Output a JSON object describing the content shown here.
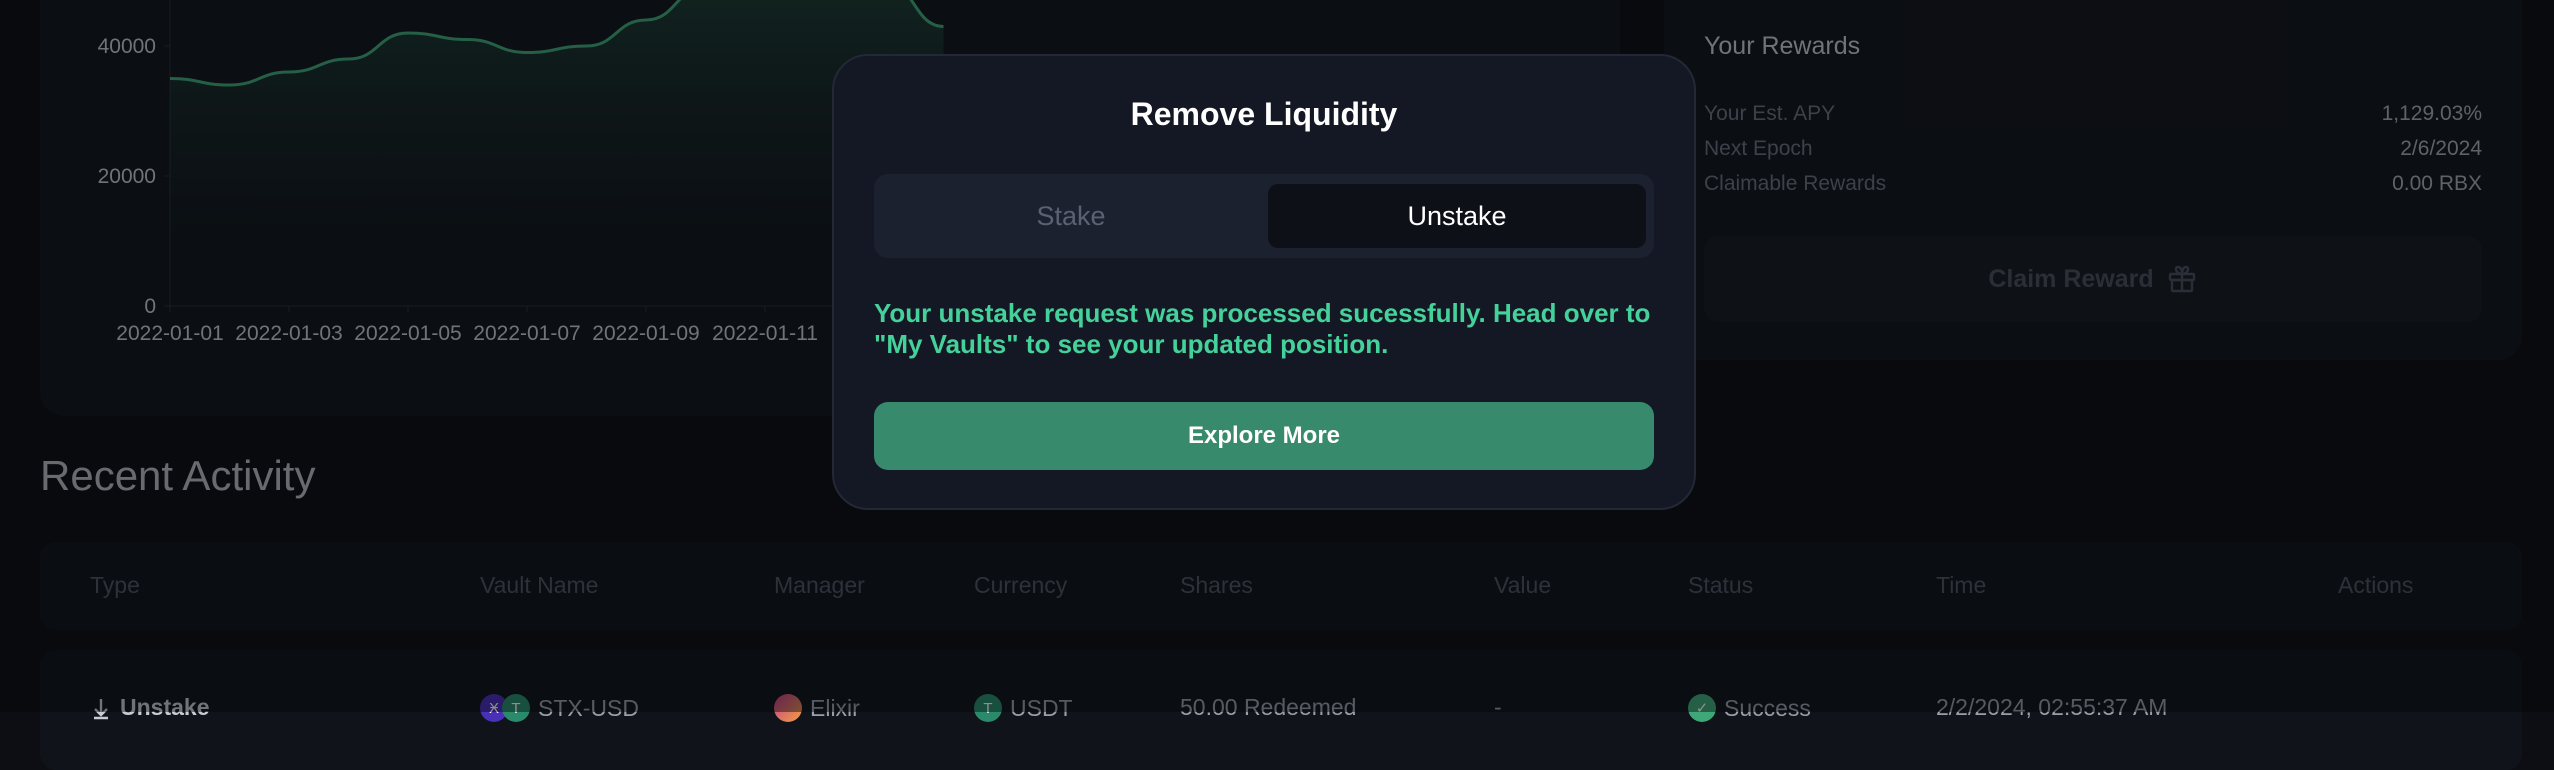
{
  "chart_data": {
    "type": "area",
    "x": [
      "2022-01-01",
      "2022-01-02",
      "2022-01-03",
      "2022-01-04",
      "2022-01-05",
      "2022-01-06",
      "2022-01-07",
      "2022-01-08",
      "2022-01-09",
      "2022-01-10",
      "2022-01-11",
      "2022-01-12",
      "2022-01-13",
      "2022-01-14"
    ],
    "values": [
      35000,
      34000,
      36000,
      38000,
      42000,
      41000,
      39000,
      40000,
      44000,
      49000,
      55000,
      60000,
      50000,
      43000
    ],
    "y_ticks": [
      0,
      20000,
      40000
    ],
    "x_tick_labels": [
      "2022-01-01",
      "2022-01-03",
      "2022-01-05",
      "2022-01-07",
      "2022-01-09",
      "2022-01-11"
    ],
    "ylim": [
      0,
      50000
    ],
    "line_color": "#3fa878",
    "title": "",
    "xlabel": "",
    "ylabel": ""
  },
  "rewards": {
    "title": "Your Rewards",
    "rows": [
      {
        "label": "Your Est. APY",
        "value": "1,129.03%"
      },
      {
        "label": "Next Epoch",
        "value": "2/6/2024"
      },
      {
        "label": "Claimable Rewards",
        "value": "0.00 RBX"
      }
    ],
    "claim_label": "Claim Reward",
    "claim_icon": "gift-icon"
  },
  "activity": {
    "title": "Recent Activity",
    "headers": [
      "Type",
      "Vault Name",
      "Manager",
      "Currency",
      "Shares",
      "Value",
      "Status",
      "Time",
      "Actions"
    ],
    "row": {
      "type": "Unstake",
      "vault": "STX-USD",
      "manager": "Elixir",
      "currency": "USDT",
      "shares": "50.00 Redeemed",
      "value": "-",
      "status": "Success",
      "time": "2/2/2024, 02:55:37 AM"
    }
  },
  "modal": {
    "title": "Remove Liquidity",
    "tabs": [
      "Stake",
      "Unstake"
    ],
    "active_tab": "Unstake",
    "message": "Your unstake request was processed sucessfully. Head over to \"My Vaults\" to see your updated position.",
    "button": "Explore More"
  },
  "colors": {
    "background": "#0c0e13",
    "panel": "#11141b",
    "accent_green": "#388a6c",
    "success_text": "#45d19a"
  }
}
